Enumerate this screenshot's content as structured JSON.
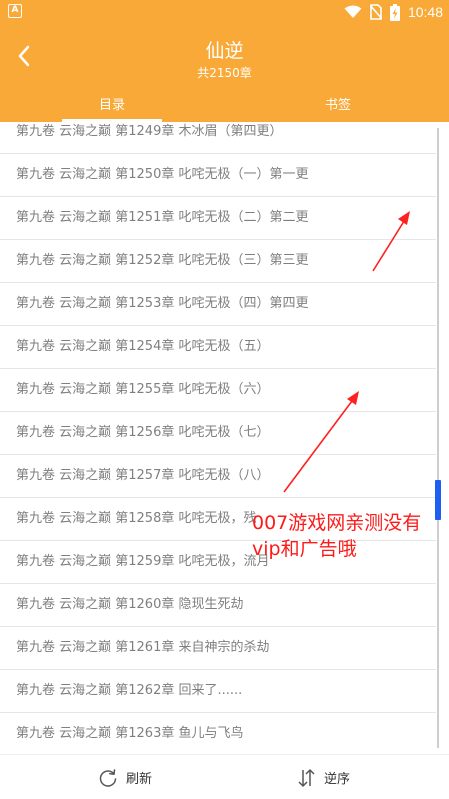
{
  "status_bar": {
    "app_icon_letter": "A",
    "time": "10:48",
    "icons": [
      "wifi-icon",
      "no-sim-icon",
      "battery-charging-icon"
    ]
  },
  "header": {
    "title": "仙逆",
    "subtitle": "共2150章",
    "tabs": [
      {
        "label": "目录",
        "active": true
      },
      {
        "label": "书签",
        "active": false
      }
    ]
  },
  "chapters": [
    "第九卷 云海之巅 第1249章 木冰眉（第四更）",
    "第九卷 云海之巅 第1250章 叱咤无极（一）第一更",
    "第九卷 云海之巅 第1251章 叱咤无极（二）第二更",
    "第九卷 云海之巅 第1252章 叱咤无极（三）第三更",
    "第九卷 云海之巅 第1253章 叱咤无极（四）第四更",
    "第九卷 云海之巅 第1254章 叱咤无极（五）",
    "第九卷 云海之巅 第1255章 叱咤无极（六）",
    "第九卷 云海之巅 第1256章 叱咤无极（七）",
    "第九卷 云海之巅 第1257章 叱咤无极（八）",
    "第九卷 云海之巅 第1258章 叱咤无极，残",
    "第九卷 云海之巅 第1259章 叱咤无极，流月",
    "第九卷 云海之巅 第1260章 隐现生死劫",
    "第九卷 云海之巅 第1261章 来自神宗的杀劫",
    "第九卷 云海之巅 第1262章 回来了......",
    "第九卷 云海之巅 第1263章 鱼儿与飞鸟"
  ],
  "overlay": {
    "text": "007游戏网亲测没有vip和广告哦",
    "color": "#ff1a1a"
  },
  "bottom_bar": {
    "refresh_label": "刷新",
    "reverse_label": "逆序"
  },
  "colors": {
    "accent": "#f9a937",
    "scrollbar_thumb": "#1e5ff2",
    "text_muted": "#7f7f7f"
  }
}
